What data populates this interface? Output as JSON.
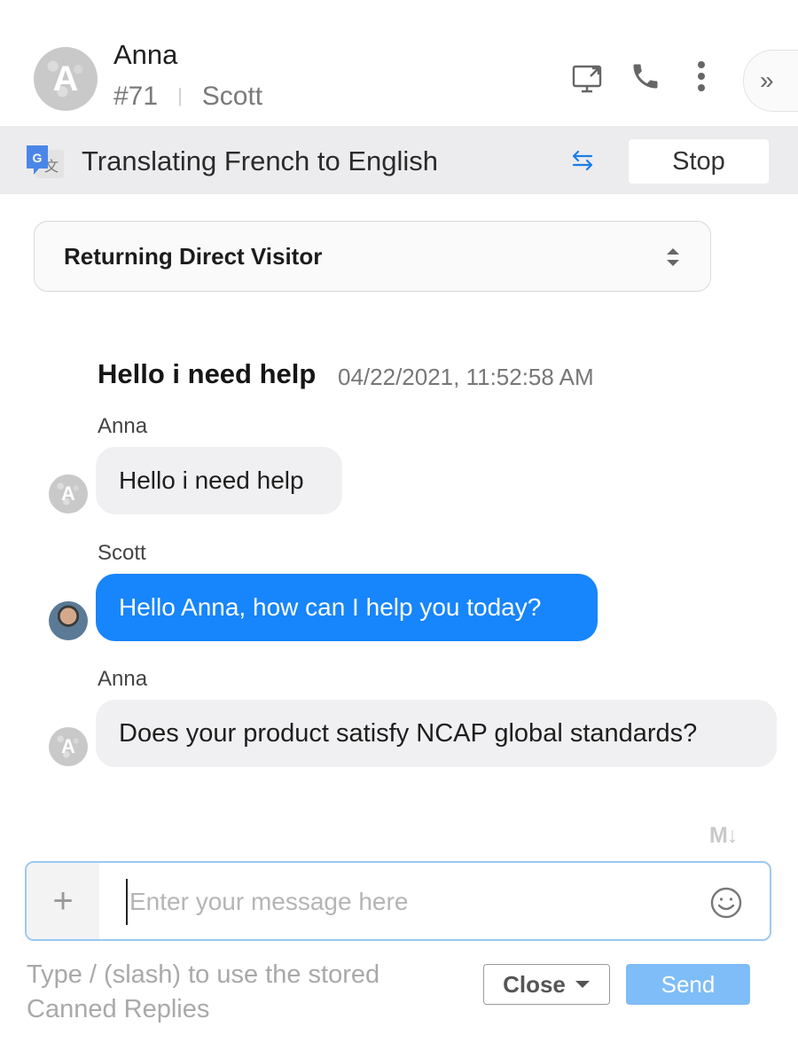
{
  "header": {
    "visitor_name": "Anna",
    "visitor_avatar_letter": "A",
    "chat_id": "#71",
    "separator": "|",
    "agent_name": "Scott",
    "icons": [
      "screen-share-icon",
      "phone-icon",
      "more-vertical-icon",
      "collapse-double-chevron-icon"
    ],
    "collapse_glyph": "»"
  },
  "translation": {
    "text": "Translating French to English",
    "stop_label": "Stop",
    "swap_icon": "swap-arrows-icon",
    "accent": "#1a7ee6"
  },
  "visitor_select": {
    "selected": "Returning Direct Visitor"
  },
  "conversation": {
    "preview_title": "Hello i need help",
    "preview_timestamp": "04/22/2021, 11:52:58 AM",
    "messages": [
      {
        "sender": "Anna",
        "text": "Hello i need help",
        "direction": "in"
      },
      {
        "sender": "Scott",
        "text": "Hello Anna, how can I help you today?",
        "direction": "out"
      },
      {
        "sender": "Anna",
        "text": "Does your product satisfy NCAP global standards?",
        "direction": "in"
      }
    ]
  },
  "composer": {
    "markdown_badge": "M↓",
    "add_glyph": "+",
    "placeholder": "Enter your message here",
    "value": "",
    "hint_line1": "Type / (slash) to use the stored",
    "hint_line2": "Canned Replies",
    "close_label": "Close",
    "send_label": "Send"
  },
  "colors": {
    "bubble_out": "#1785fb",
    "bubble_in": "#f0f0f2",
    "send_button": "#7ebdf7",
    "translation_bar": "#ececee"
  }
}
